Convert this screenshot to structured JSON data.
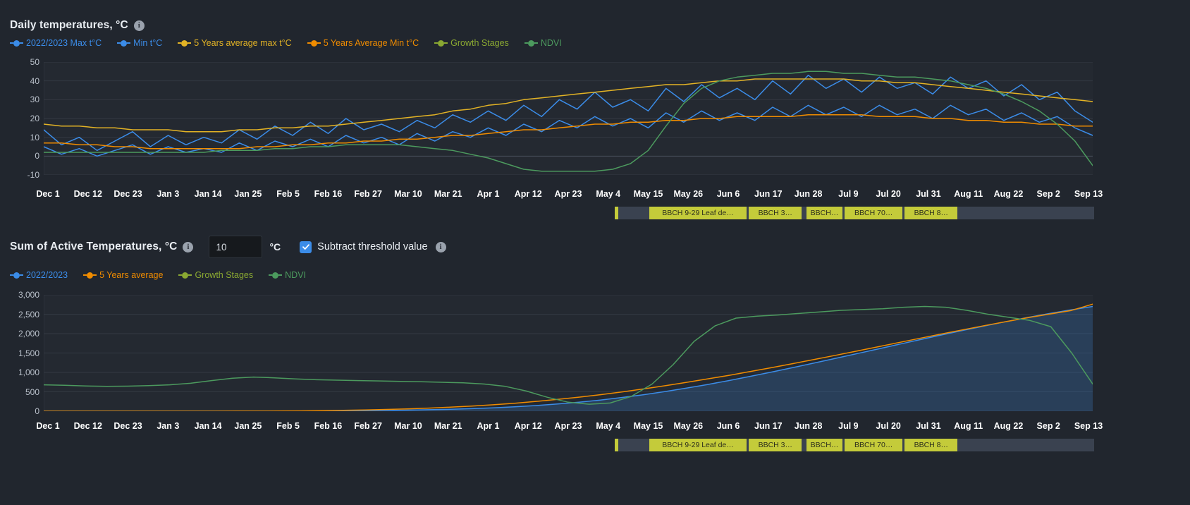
{
  "theme": {
    "background": "#21262e",
    "plot_background": "#242931",
    "grid": "#333942",
    "axis_text": "#b9c0ca",
    "tick_text": "#ffffff",
    "series_blue": "#3b8ce8",
    "series_yellow": "#e3b325",
    "series_orange": "#f08c00",
    "series_growth": "#8aa832",
    "series_ndvi": "#4c9a5e",
    "growth_bar": "#c4cb3a",
    "checkbox_blue": "#3b8ce8"
  },
  "panel1": {
    "title": "Daily temperatures, °C",
    "info_icon": "info-icon",
    "legend": [
      {
        "label": "2022/2023 Max t°C",
        "color": "#3b8ce8"
      },
      {
        "label": "Min t°C",
        "color": "#3b8ce8"
      },
      {
        "label": "5 Years average max t°C",
        "color": "#e3b325"
      },
      {
        "label": "5 Years Average Min t°C",
        "color": "#f08c00"
      },
      {
        "label": "Growth Stages",
        "color": "#8aa832"
      },
      {
        "label": "NDVI",
        "color": "#4c9a5e"
      }
    ]
  },
  "panel2": {
    "title": "Sum of Active Temperatures, °C",
    "info_icon": "info-icon",
    "threshold_value": "10",
    "threshold_placeholder": "10",
    "unit": "°C",
    "checkbox_checked": true,
    "checkbox_label": "Subtract threshold value",
    "checkbox_info_icon": "info-icon",
    "legend": [
      {
        "label": "2022/2023",
        "color": "#3b8ce8"
      },
      {
        "label": "5 Years average",
        "color": "#f08c00"
      },
      {
        "label": "Growth Stages",
        "color": "#8aa832"
      },
      {
        "label": "NDVI",
        "color": "#4c9a5e"
      }
    ]
  },
  "x_ticks": [
    "Dec 1",
    "Dec 12",
    "Dec 23",
    "Jan 3",
    "Jan 14",
    "Jan 25",
    "Feb 5",
    "Feb 16",
    "Feb 27",
    "Mar 10",
    "Mar 21",
    "Apr 1",
    "Apr 12",
    "Apr 23",
    "May 4",
    "May 15",
    "May 26",
    "Jun 6",
    "Jun 17",
    "Jun 28",
    "Jul 9",
    "Jul 20",
    "Jul 31",
    "Aug 11",
    "Aug 22",
    "Sep 2",
    "Sep 13"
  ],
  "growth_stages": [
    {
      "label": "",
      "start": 0.0,
      "end": 0.008,
      "color": "#c4cb3a"
    },
    {
      "label": "",
      "start": 0.008,
      "end": 0.072,
      "color": "#3a4250"
    },
    {
      "label": "BBCH 9-29 Leaf de…",
      "start": 0.072,
      "end": 0.275,
      "color": "#c4cb3a"
    },
    {
      "label": "BBCH 3…",
      "start": 0.28,
      "end": 0.39,
      "color": "#c4cb3a"
    },
    {
      "label": "BBCH…",
      "start": 0.4,
      "end": 0.475,
      "color": "#c4cb3a"
    },
    {
      "label": "BBCH 70…",
      "start": 0.48,
      "end": 0.6,
      "color": "#c4cb3a"
    },
    {
      "label": "BBCH 8…",
      "start": 0.605,
      "end": 0.715,
      "color": "#c4cb3a"
    },
    {
      "label": "",
      "start": 0.715,
      "end": 1.0,
      "color": "#3a4250"
    }
  ],
  "chart_data": [
    {
      "id": "daily-temperatures",
      "type": "line",
      "title": "Daily temperatures, °C",
      "xlabel": "",
      "ylabel": "°C",
      "ylim": [
        -10,
        50
      ],
      "yticks": [
        -10,
        0,
        10,
        20,
        30,
        40,
        50
      ],
      "grid": true,
      "legend_position": "top-left",
      "x": [
        "Dec 1",
        "Dec 12",
        "Dec 23",
        "Jan 3",
        "Jan 14",
        "Jan 25",
        "Feb 5",
        "Feb 16",
        "Feb 27",
        "Mar 10",
        "Mar 21",
        "Apr 1",
        "Apr 12",
        "Apr 23",
        "May 4",
        "May 15",
        "May 26",
        "Jun 6",
        "Jun 17",
        "Jun 28",
        "Jul 9",
        "Jul 20",
        "Jul 31",
        "Aug 11",
        "Aug 22",
        "Sep 2",
        "Sep 13"
      ],
      "series": [
        {
          "name": "2022/2023 Max t°C",
          "color": "#3b8ce8",
          "values": [
            14,
            6,
            10,
            3,
            8,
            13,
            5,
            11,
            6,
            10,
            7,
            14,
            9,
            16,
            11,
            18,
            12,
            20,
            14,
            17,
            13,
            19,
            15,
            22,
            18,
            24,
            19,
            27,
            21,
            30,
            25,
            34,
            26,
            30,
            24,
            36,
            29,
            38,
            31,
            36,
            30,
            40,
            33,
            43,
            36,
            41,
            34,
            42,
            36,
            39,
            33,
            42,
            36,
            40,
            32,
            38,
            30,
            34,
            24,
            18
          ]
        },
        {
          "name": "Min t°C",
          "color": "#3b8ce8",
          "values": [
            5,
            1,
            4,
            0,
            3,
            6,
            1,
            5,
            2,
            4,
            2,
            7,
            3,
            8,
            5,
            9,
            5,
            11,
            7,
            10,
            6,
            12,
            8,
            13,
            10,
            15,
            11,
            17,
            13,
            19,
            15,
            21,
            16,
            20,
            15,
            23,
            18,
            24,
            19,
            23,
            19,
            26,
            21,
            27,
            22,
            26,
            21,
            27,
            22,
            25,
            20,
            27,
            22,
            25,
            19,
            23,
            18,
            21,
            15,
            11
          ]
        },
        {
          "name": "5 Years average max t°C",
          "color": "#e3b325",
          "values": [
            17,
            16,
            16,
            15,
            15,
            14,
            14,
            14,
            13,
            13,
            13,
            14,
            14,
            15,
            15,
            16,
            16,
            17,
            18,
            19,
            20,
            21,
            22,
            24,
            25,
            27,
            28,
            30,
            31,
            32,
            33,
            34,
            35,
            36,
            37,
            38,
            38,
            39,
            40,
            40,
            41,
            41,
            41,
            41,
            41,
            41,
            40,
            40,
            39,
            39,
            38,
            37,
            36,
            35,
            34,
            33,
            32,
            31,
            30,
            29
          ]
        },
        {
          "name": "5 Years Average Min t°C",
          "color": "#f08c00",
          "values": [
            7,
            7,
            6,
            6,
            5,
            5,
            4,
            4,
            4,
            4,
            4,
            4,
            5,
            5,
            6,
            6,
            7,
            7,
            8,
            8,
            9,
            9,
            10,
            11,
            11,
            12,
            13,
            14,
            14,
            15,
            16,
            17,
            17,
            18,
            18,
            19,
            19,
            20,
            20,
            21,
            21,
            21,
            21,
            22,
            22,
            22,
            22,
            21,
            21,
            21,
            20,
            20,
            19,
            19,
            18,
            18,
            17,
            17,
            16,
            16
          ]
        },
        {
          "name": "NDVI",
          "color": "#4c9a5e",
          "values": [
            2,
            2,
            2,
            2,
            2,
            2,
            2,
            2,
            2,
            2,
            3,
            3,
            3,
            4,
            4,
            5,
            5,
            6,
            6,
            6,
            6,
            5,
            4,
            3,
            1,
            -1,
            -4,
            -7,
            -8,
            -8,
            -8,
            -8,
            -7,
            -4,
            3,
            16,
            28,
            36,
            40,
            42,
            43,
            44,
            44,
            45,
            45,
            44,
            44,
            43,
            42,
            42,
            41,
            40,
            38,
            36,
            33,
            29,
            24,
            17,
            8,
            -5
          ]
        }
      ]
    },
    {
      "id": "sum-of-active-temperatures",
      "type": "area",
      "title": "Sum of Active Temperatures, °C",
      "xlabel": "",
      "ylabel": "°C",
      "ylim": [
        0,
        3000
      ],
      "yticks": [
        0,
        500,
        1000,
        1500,
        2000,
        2500,
        3000
      ],
      "grid": true,
      "legend_position": "top-left",
      "x": [
        "Dec 1",
        "Dec 12",
        "Dec 23",
        "Jan 3",
        "Jan 14",
        "Jan 25",
        "Feb 5",
        "Feb 16",
        "Feb 27",
        "Mar 10",
        "Mar 21",
        "Apr 1",
        "Apr 12",
        "Apr 23",
        "May 4",
        "May 15",
        "May 26",
        "Jun 6",
        "Jun 17",
        "Jun 28",
        "Jul 9",
        "Jul 20",
        "Jul 31",
        "Aug 11",
        "Aug 22",
        "Sep 2",
        "Sep 13"
      ],
      "series": [
        {
          "name": "2022/2023",
          "color": "#3b8ce8",
          "fill": true,
          "values": [
            0,
            0,
            0,
            0,
            0,
            0,
            0,
            0,
            0,
            0,
            0,
            0,
            2,
            5,
            9,
            14,
            20,
            28,
            38,
            50,
            66,
            86,
            112,
            145,
            185,
            232,
            288,
            352,
            424,
            504,
            592,
            688,
            790,
            898,
            1010,
            1126,
            1244,
            1364,
            1486,
            1608,
            1730,
            1852,
            1972,
            2090,
            2204,
            2314,
            2420,
            2520,
            2612,
            2700
          ]
        },
        {
          "name": "5 Years average",
          "color": "#f08c00",
          "fill": false,
          "values": [
            0,
            0,
            0,
            0,
            0,
            0,
            0,
            0,
            0,
            1,
            2,
            4,
            8,
            14,
            22,
            32,
            45,
            60,
            80,
            104,
            132,
            166,
            206,
            252,
            304,
            362,
            426,
            496,
            572,
            654,
            740,
            830,
            924,
            1022,
            1124,
            1228,
            1334,
            1442,
            1552,
            1664,
            1776,
            1888,
            1998,
            2106,
            2212,
            2314,
            2412,
            2506,
            2596,
            2760
          ]
        },
        {
          "name": "NDVI",
          "color": "#4c9a5e",
          "fill": false,
          "values": [
            680,
            670,
            650,
            640,
            645,
            660,
            680,
            720,
            790,
            850,
            880,
            860,
            830,
            810,
            800,
            790,
            780,
            770,
            760,
            745,
            730,
            700,
            640,
            520,
            360,
            230,
            180,
            210,
            380,
            700,
            1200,
            1800,
            2200,
            2400,
            2450,
            2480,
            2520,
            2560,
            2600,
            2620,
            2640,
            2680,
            2700,
            2680,
            2600,
            2500,
            2420,
            2340,
            2180,
            1500,
            700
          ]
        }
      ]
    }
  ]
}
